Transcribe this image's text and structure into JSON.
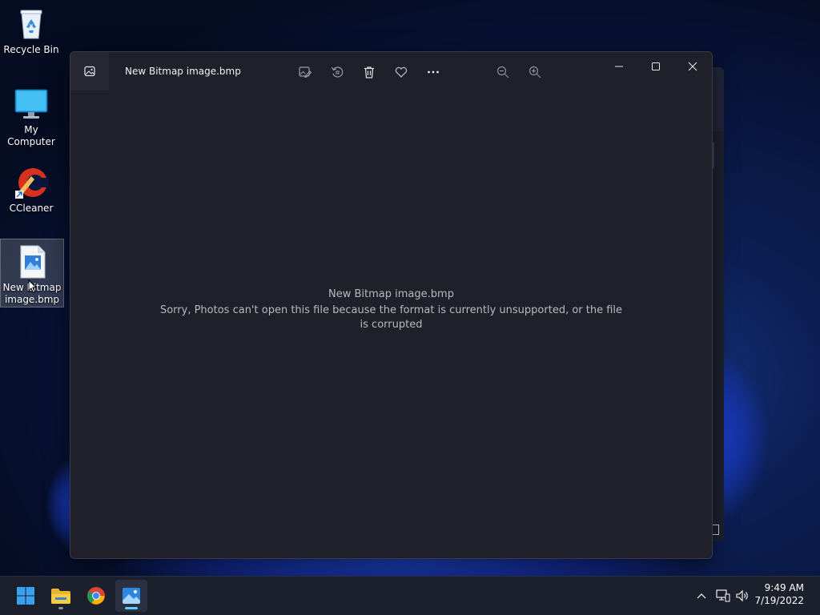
{
  "desktop": {
    "icons": [
      {
        "label": "Recycle Bin"
      },
      {
        "label": "My Computer"
      },
      {
        "label": "CCleaner"
      },
      {
        "label": "New Bitmap image.bmp"
      }
    ]
  },
  "window": {
    "title": "New Bitmap image.bmp",
    "toolbar": [
      {
        "icon": "edit-image-icon"
      },
      {
        "icon": "rotate-icon"
      },
      {
        "icon": "delete-icon"
      },
      {
        "icon": "favorite-heart-icon"
      },
      {
        "icon": "more-options-icon"
      },
      {
        "icon": "zoom-out-icon"
      },
      {
        "icon": "zoom-in-icon"
      }
    ],
    "message_title": "New Bitmap image.bmp",
    "message_body": "Sorry, Photos can't open this file because the format is currently unsupported, or the file is corrupted"
  },
  "taskbar": {
    "apps": [
      {
        "name": "start",
        "icon": "windows-logo-icon"
      },
      {
        "name": "file-explorer",
        "icon": "folder-icon"
      },
      {
        "name": "chrome",
        "icon": "chrome-icon"
      },
      {
        "name": "photos",
        "icon": "photos-icon"
      }
    ],
    "time": "9:49 AM",
    "date": "7/19/2022"
  },
  "colors": {
    "accent": "#60cdff",
    "window_bg": "#1f2029",
    "taskbar_bg": "#1c1f2c"
  }
}
